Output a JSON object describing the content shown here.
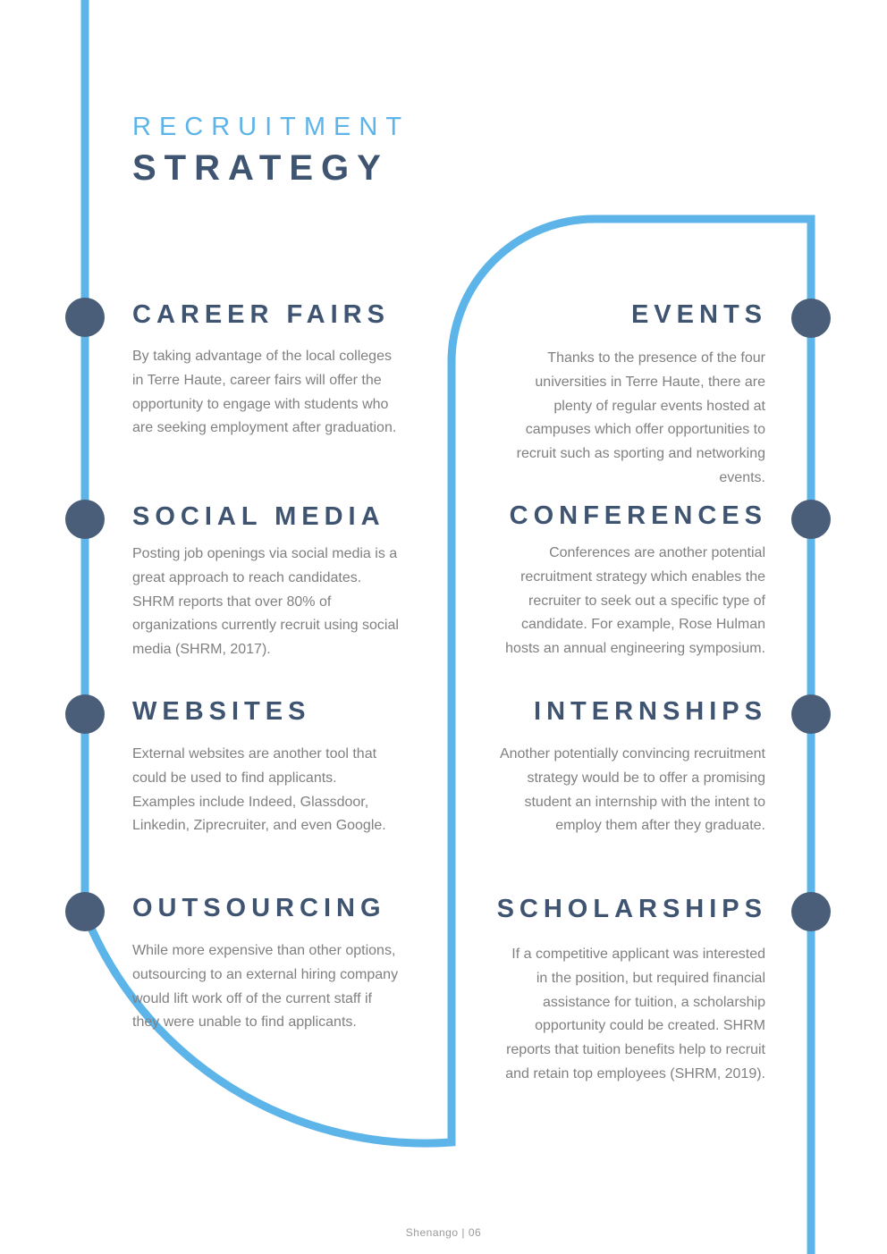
{
  "header": {
    "title_top": "RECRUITMENT",
    "title_main": "STRATEGY"
  },
  "colors": {
    "accent_blue": "#5db4e8",
    "heading_navy": "#3f5471",
    "dot_navy": "#4a5e79",
    "body_gray": "#808080"
  },
  "sections": {
    "career_fairs": {
      "title": "CAREER FAIRS",
      "body": "By taking advantage of the local colleges in Terre Haute, career fairs will offer the opportunity to engage with students who are seeking employment after graduation."
    },
    "events": {
      "title": "EVENTS",
      "body": "Thanks to the presence of the four universities in Terre Haute, there are plenty of regular events hosted at campuses which offer opportunities to recruit such as sporting and networking events."
    },
    "social_media": {
      "title": "SOCIAL MEDIA",
      "body": "Posting job openings via social media is a great approach to reach candidates. SHRM reports that over 80% of organizations currently recruit using social media (SHRM, 2017)."
    },
    "conferences": {
      "title": "CONFERENCES",
      "body": "Conferences are another potential recruitment strategy which enables the recruiter to seek out a specific type of candidate. For example, Rose Hulman hosts an annual engineering symposium."
    },
    "websites": {
      "title": "WEBSITES",
      "body": "External websites are another tool that could be used to find applicants. Examples include Indeed, Glassdoor, Linkedin, Ziprecruiter, and even Google."
    },
    "internships": {
      "title": "INTERNSHIPS",
      "body": "Another potentially convincing recruitment strategy would be to offer a promising student an internship with the intent to employ them after they graduate."
    },
    "outsourcing": {
      "title": "OUTSOURCING",
      "body": "While more expensive than other options, outsourcing to an external hiring company would lift work off of the current staff if they were unable to find applicants."
    },
    "scholarships": {
      "title": "SCHOLARSHIPS",
      "body": "If a competitive applicant was interested in the position, but required financial assistance for tuition, a scholarship opportunity could be created. SHRM reports that tuition benefits help to recruit and retain top employees (SHRM, 2019)."
    }
  },
  "footer": {
    "brand": "Shenango",
    "separator": "|",
    "page_number": "06"
  }
}
